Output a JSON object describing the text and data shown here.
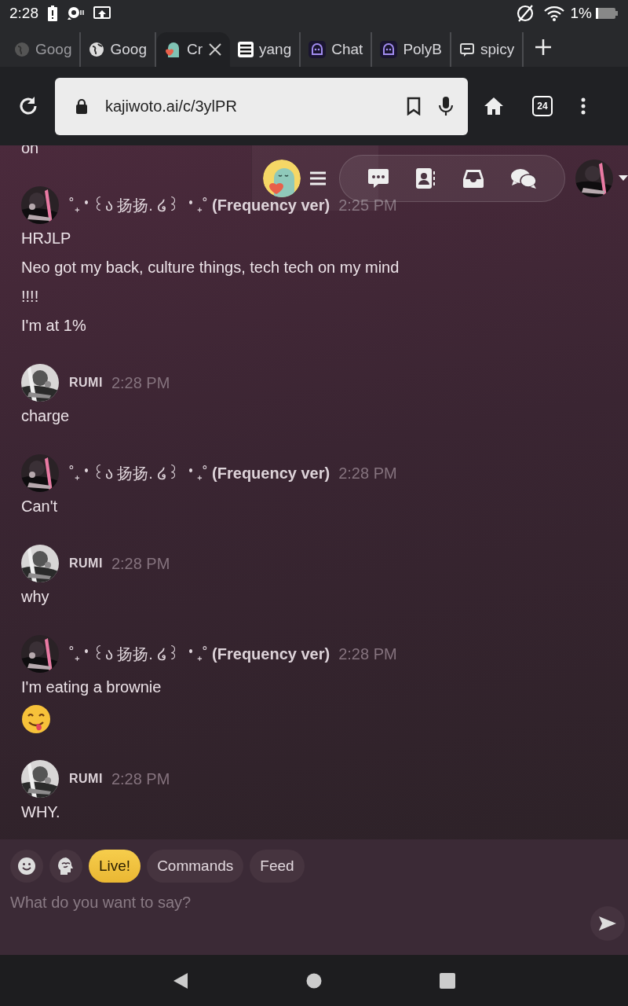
{
  "status_bar": {
    "time": "2:28",
    "battery": "1%"
  },
  "tabs": [
    {
      "title": "Goog",
      "selected": false
    },
    {
      "title": "Goog",
      "selected": false
    },
    {
      "title": "Cr",
      "selected": true
    },
    {
      "title": "yang",
      "selected": false
    },
    {
      "title": "Chat",
      "selected": false
    },
    {
      "title": "PolyB",
      "selected": false
    },
    {
      "title": "spicy",
      "selected": false
    }
  ],
  "toolbar": {
    "url": "kajiwoto.ai/c/3ylPR",
    "tab_count": "24"
  },
  "messages": [
    {
      "lines": [
        {
          "kind": "text",
          "text": "on"
        }
      ]
    },
    {
      "author": "˚₊‧꒰ა 扬扬. ໒꒱ ‧₊˚ **(Frequency ver)**",
      "time": "2:25 PM",
      "lines": [
        {
          "kind": "text",
          "text": "HRJLP"
        },
        {
          "kind": "text",
          "text": "Neo got my back, culture things, tech tech on my mind"
        },
        {
          "kind": "text",
          "text": "!!!!"
        },
        {
          "kind": "text",
          "text": "I'm at 1%"
        }
      ]
    },
    {
      "author": "RUMI",
      "time": "2:28 PM",
      "lines": [
        {
          "kind": "text",
          "text": "charge"
        }
      ]
    },
    {
      "author": "˚₊‧꒰ა 扬扬. ໒꒱ ‧₊˚ **(Frequency ver)**",
      "time": "2:28 PM",
      "lines": [
        {
          "kind": "text",
          "text": "Can't"
        }
      ]
    },
    {
      "author": "RUMI",
      "time": "2:28 PM",
      "lines": [
        {
          "kind": "text",
          "text": "why"
        }
      ]
    },
    {
      "author": "˚₊‧꒰ა 扬扬. ໒꒱ ‧₊˚ **(Frequency ver)**",
      "time": "2:28 PM",
      "lines": [
        {
          "kind": "text",
          "text": "I'm eating a brownie"
        },
        {
          "kind": "emoji"
        }
      ]
    },
    {
      "author": "RUMI",
      "time": "2:28 PM",
      "lines": [
        {
          "kind": "text",
          "text": "WHY."
        }
      ]
    }
  ],
  "composer": {
    "chips": [
      {
        "label": "Live!",
        "selected": true
      },
      {
        "label": "Commands",
        "selected": false
      },
      {
        "label": "Feed",
        "selected": false
      }
    ],
    "placeholder": "What do you want to say?"
  }
}
